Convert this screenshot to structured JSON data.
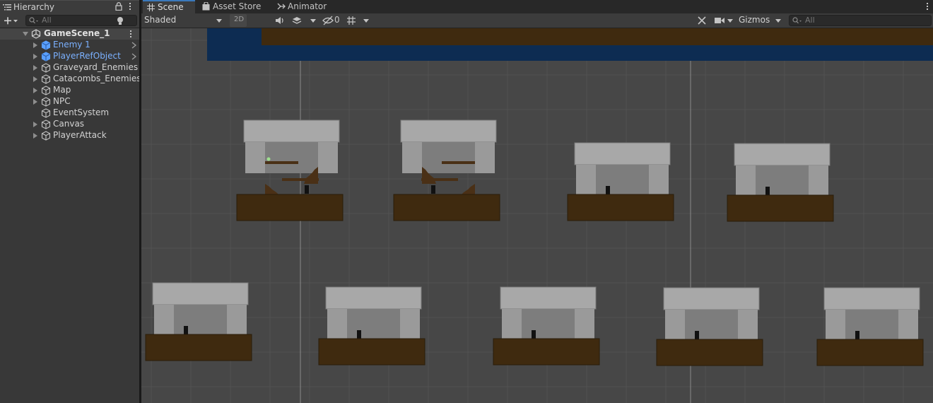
{
  "hierarchy": {
    "tab_label": "Hierarchy",
    "search_placeholder": "All",
    "scene_name": "GameScene_1",
    "items": [
      {
        "label": "Enemy 1",
        "prefab": true,
        "expandable": true
      },
      {
        "label": "PlayerRefObject",
        "prefab": true,
        "expandable": true
      },
      {
        "label": "Graveyard_Enemies",
        "prefab": false,
        "expandable": true
      },
      {
        "label": "Catacombs_Enemies",
        "prefab": false,
        "expandable": true
      },
      {
        "label": "Map",
        "prefab": false,
        "expandable": true
      },
      {
        "label": "NPC",
        "prefab": false,
        "expandable": true
      },
      {
        "label": "EventSystem",
        "prefab": false,
        "expandable": false
      },
      {
        "label": "Canvas",
        "prefab": false,
        "expandable": true
      },
      {
        "label": "PlayerAttack",
        "prefab": false,
        "expandable": true
      }
    ]
  },
  "tabs": [
    {
      "label": "Scene",
      "active": true,
      "icon": "grid-icon"
    },
    {
      "label": "Asset Store",
      "active": false,
      "icon": "bag-icon"
    },
    {
      "label": "Animator",
      "active": false,
      "icon": "animator-icon"
    }
  ],
  "scene_toolbar": {
    "shading_mode": "Shaded",
    "mode_2d": "2D",
    "hidden_count": "0",
    "gizmos_label": "Gizmos",
    "search_placeholder": "All"
  },
  "colors": {
    "prefab_text": "#7bb1ff",
    "active_tab_accent": "#3a79bb",
    "scene_background": "#474747",
    "platform_brown": "#3f2a0f",
    "wall_grey": "#9a9a9a"
  }
}
